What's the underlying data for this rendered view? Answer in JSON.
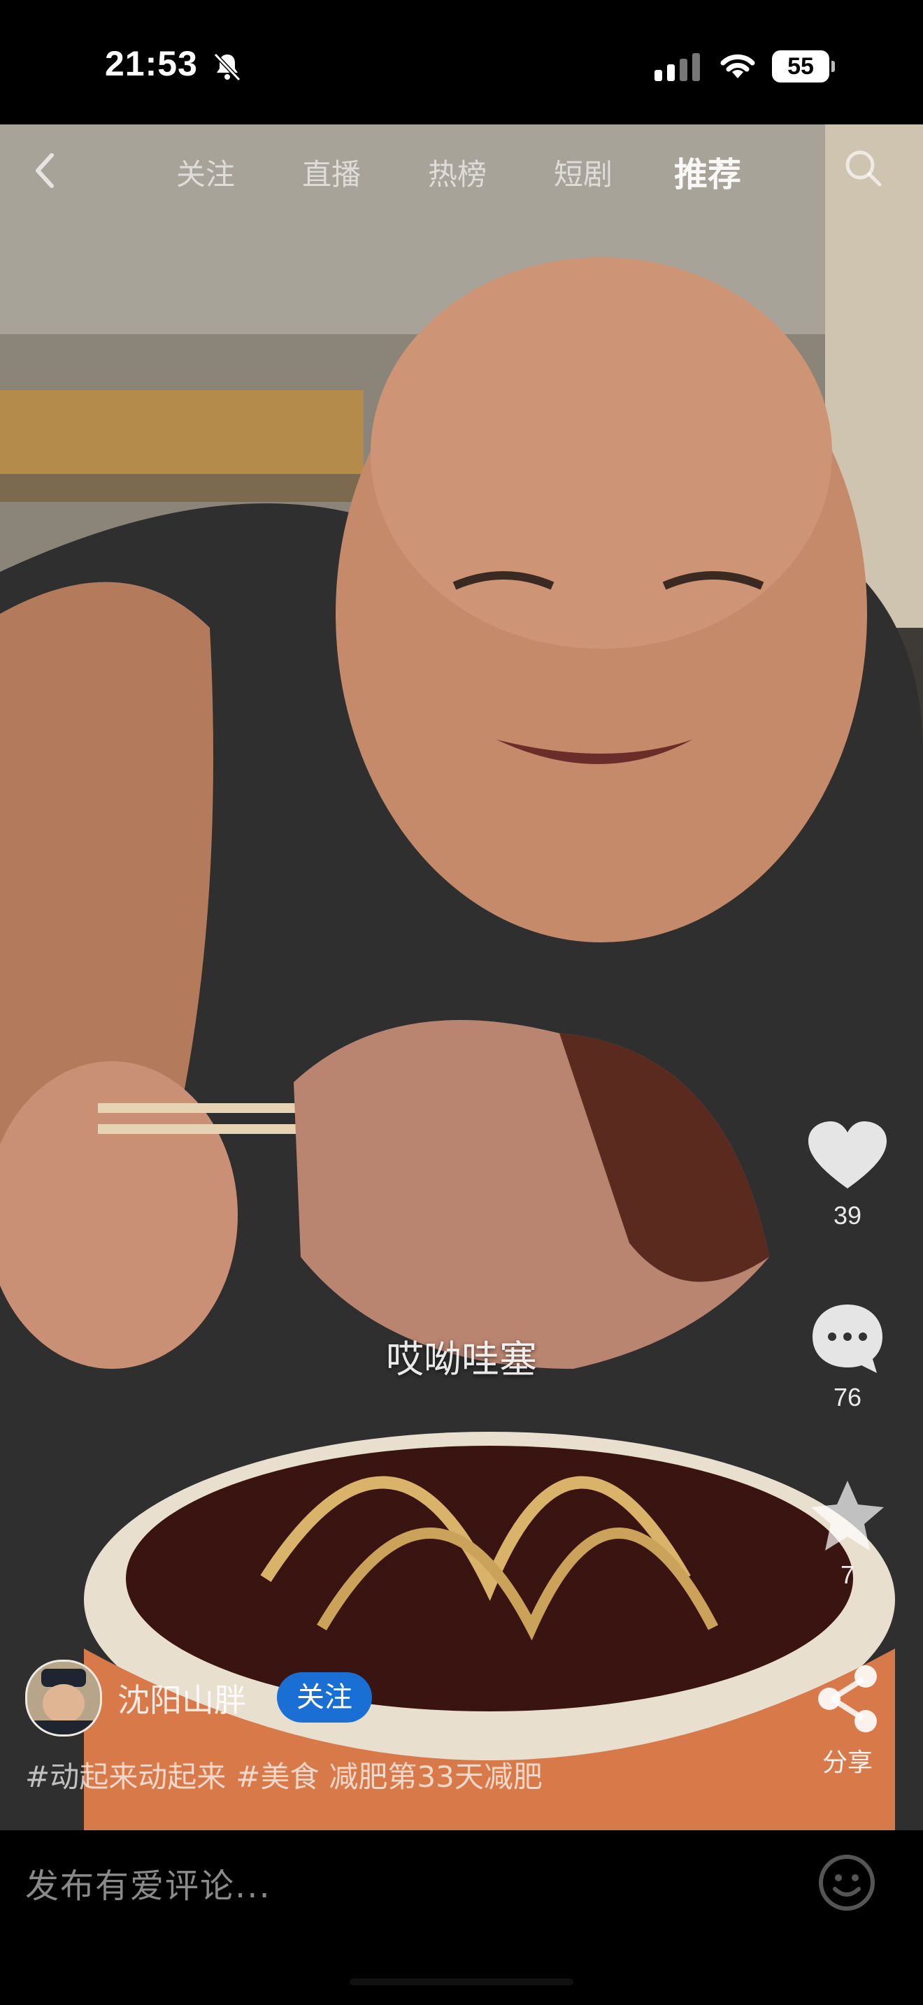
{
  "status_bar": {
    "time": "21:53",
    "battery": "55"
  },
  "nav": {
    "tabs": [
      {
        "label": "关注",
        "active": false
      },
      {
        "label": "直播",
        "active": false
      },
      {
        "label": "热榜",
        "active": false
      },
      {
        "label": "短剧",
        "active": false
      },
      {
        "label": "推荐",
        "active": true
      }
    ]
  },
  "video": {
    "subtitle": "哎呦哇塞"
  },
  "actions": {
    "like_count": "39",
    "comment_count": "76",
    "favorite_count": "7",
    "share_label": "分享"
  },
  "author": {
    "name": "沈阳山胖",
    "follow_label": "关注"
  },
  "caption": {
    "tags": [
      "#动起来动起来",
      "#美食"
    ],
    "text": "减肥第33天减肥"
  },
  "comment_bar": {
    "placeholder": "发布有爱评论..."
  },
  "icons": {
    "back": "chevron-left-icon",
    "search": "search-icon",
    "like": "heart-icon",
    "comment": "comment-icon",
    "favorite": "star-icon",
    "share": "share-icon",
    "emoji": "smiley-icon"
  }
}
